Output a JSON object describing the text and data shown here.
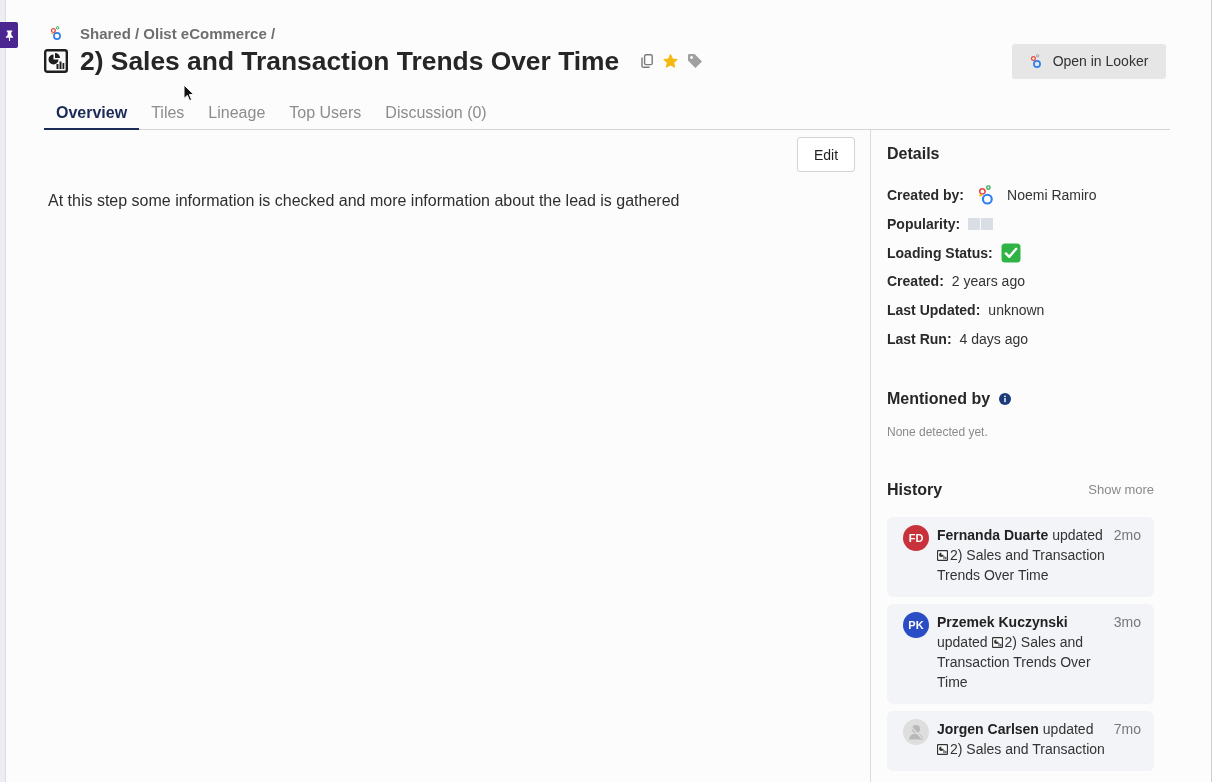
{
  "header": {
    "breadcrumb": "Shared / Olist eCommerce /",
    "title": "2) Sales and Transaction Trends Over Time",
    "starred": true,
    "open_button": "Open in Looker"
  },
  "tabs": [
    {
      "label": "Overview",
      "selected": true
    },
    {
      "label": "Tiles",
      "selected": false
    },
    {
      "label": "Lineage",
      "selected": false
    },
    {
      "label": "Top Users",
      "selected": false
    },
    {
      "label": "Discussion (0)",
      "selected": false
    }
  ],
  "overview": {
    "edit_button": "Edit",
    "description": "At this step some information is checked and more information about the lead is gathered"
  },
  "details": {
    "title": "Details",
    "rows": [
      {
        "kind": "user",
        "label": "Created by:",
        "value": "Noemi Ramiro"
      },
      {
        "kind": "squares",
        "label": "Popularity:"
      },
      {
        "kind": "status",
        "label": "Loading Status:",
        "ok": true
      },
      {
        "kind": "text",
        "label": "Created:",
        "value": "2 years ago"
      },
      {
        "kind": "text",
        "label": "Last Updated:",
        "value": "unknown"
      },
      {
        "kind": "text",
        "label": "Last Run:",
        "value": "4 days ago"
      }
    ]
  },
  "mentioned_by": {
    "title": "Mentioned by",
    "empty_text": "None detected yet."
  },
  "history": {
    "title": "History",
    "more": "Show more",
    "items": [
      {
        "user": "Fernanda Duarte",
        "action": "updated",
        "target": "2) Sales and Transaction Trends Over Time",
        "time": "2mo",
        "avatar": {
          "kind": "initials",
          "initials": "FD",
          "color": "#c7323b"
        }
      },
      {
        "user": "Przemek Kuczynski",
        "action": "updated",
        "target": "2) Sales and Transaction Trends Over Time",
        "time": "3mo",
        "avatar": {
          "kind": "initials",
          "initials": "PK",
          "color": "#2a4cc4"
        }
      },
      {
        "user": "Jorgen Carlsen",
        "action": "updated",
        "target": "2) Sales and Transaction",
        "time": "7mo",
        "avatar": {
          "kind": "placeholder"
        }
      }
    ]
  }
}
